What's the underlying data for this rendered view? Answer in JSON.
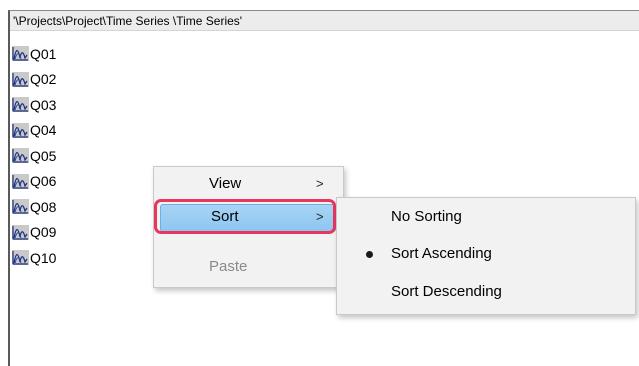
{
  "path_bar": {
    "text": "'\\Projects\\Project\\Time Series \\Time Series'"
  },
  "list": {
    "icon": "time-series-chart-icon",
    "items": [
      "Q01",
      "Q02",
      "Q03",
      "Q04",
      "Q05",
      "Q06",
      "Q08",
      "Q09",
      "Q10"
    ]
  },
  "context_menu": {
    "items": [
      {
        "label": "View",
        "has_submenu": true,
        "disabled": false
      },
      {
        "label": "Sort",
        "has_submenu": true,
        "disabled": false,
        "highlighted": true
      },
      {
        "label": "Paste",
        "has_submenu": false,
        "disabled": true
      }
    ],
    "submenu_arrow": ">"
  },
  "sort_submenu": {
    "items": [
      {
        "label": "No Sorting",
        "selected": false
      },
      {
        "label": "Sort Ascending",
        "selected": true
      },
      {
        "label": "Sort Descending",
        "selected": false
      }
    ]
  },
  "colors": {
    "highlight": "#8ec6f0",
    "annotation_ring": "#e8365f",
    "menu_background": "#f2f2f2",
    "disabled_text": "#8a8a8a"
  }
}
